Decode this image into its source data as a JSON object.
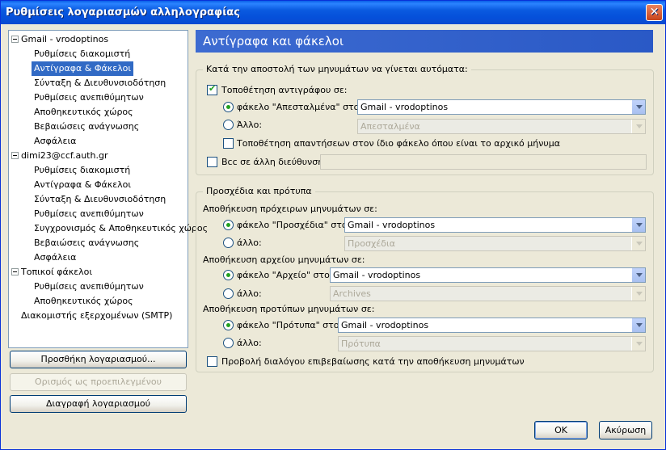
{
  "window": {
    "title": "Ρυθμίσεις λογαριασμών αλληλογραφίας",
    "close_glyph": "✕"
  },
  "tree": [
    {
      "label": "Gmail - vrodoptinos",
      "level": 0,
      "toggle": true
    },
    {
      "label": "Ρυθμίσεις διακομιστή",
      "level": 1
    },
    {
      "label": "Αντίγραφα & Φάκελοι",
      "level": 1,
      "selected": true
    },
    {
      "label": "Σύνταξη & Διευθυνσιοδότηση",
      "level": 1
    },
    {
      "label": "Ρυθμίσεις ανεπιθύμητων",
      "level": 1
    },
    {
      "label": "Αποθηκευτικός χώρος",
      "level": 1
    },
    {
      "label": "Βεβαιώσεις ανάγνωσης",
      "level": 1
    },
    {
      "label": "Ασφάλεια",
      "level": 1
    },
    {
      "label": "dimi23@ccf.auth.gr",
      "level": 0,
      "toggle": true
    },
    {
      "label": "Ρυθμίσεις διακομιστή",
      "level": 1
    },
    {
      "label": "Αντίγραφα & Φάκελοι",
      "level": 1
    },
    {
      "label": "Σύνταξη & Διευθυνσιοδότηση",
      "level": 1
    },
    {
      "label": "Ρυθμίσεις ανεπιθύμητων",
      "level": 1
    },
    {
      "label": "Συγχρονισμός & Αποθηκευτικός χώρος",
      "level": 1
    },
    {
      "label": "Βεβαιώσεις ανάγνωσης",
      "level": 1
    },
    {
      "label": "Ασφάλεια",
      "level": 1
    },
    {
      "label": "Τοπικοί φάκελοι",
      "level": 0,
      "toggle": true
    },
    {
      "label": "Ρυθμίσεις ανεπιθύμητων",
      "level": 1
    },
    {
      "label": "Αποθηκευτικός χώρος",
      "level": 1
    },
    {
      "label": "Διακομιστής εξερχομένων (SMTP)",
      "level": 0
    }
  ],
  "left_buttons": {
    "add": "Προσθήκη λογαριασμού...",
    "set_default": "Ορισμός ως προεπιλεγμένου",
    "remove": "Διαγραφή λογαριασμού"
  },
  "header": {
    "title": "Αντίγραφα και φάκελοι"
  },
  "sending": {
    "group_title": "Κατά την αποστολή των μηνυμάτων να γίνεται αυτόματα:",
    "place_copy": {
      "label": "Τοποθέτηση αντιγράφου σε:",
      "checked": true
    },
    "sent_folder": {
      "label": "φάκελο \"Απεσταλμένα\" στο:",
      "checked": true,
      "value": "Gmail - vrodoptinos"
    },
    "other": {
      "label": "Άλλο:",
      "value": "Απεσταλμένα"
    },
    "reply_same": {
      "label": "Τοποθέτηση απαντήσεων στον ίδιο φάκελο όπου είναι το αρχικό μήνυμα",
      "checked": false
    },
    "bcc": {
      "label": "Bcc σε άλλη διεύθυνση",
      "checked": false,
      "value": ""
    }
  },
  "drafts": {
    "group_title": "Προσχέδια και πρότυπα",
    "drafts_label": "Αποθήκευση πρόχειρων μηνυμάτων σε:",
    "drafts_folder": {
      "label": "φάκελο \"Προσχέδια\" στο:",
      "value": "Gmail - vrodoptinos"
    },
    "drafts_other": {
      "label": "άλλο:",
      "value": "Προσχέδια"
    },
    "archive_label": "Αποθήκευση αρχείου μηνυμάτων σε:",
    "archive_folder": {
      "label": "φάκελο \"Αρχείο\" στο:",
      "value": "Gmail - vrodoptinos"
    },
    "archive_other": {
      "label": "άλλο:",
      "value": "Archives"
    },
    "templates_label": "Αποθήκευση προτύπων μηνυμάτων σε:",
    "templates_folder": {
      "label": "φάκελο \"Πρότυπα\" στο:",
      "value": "Gmail - vrodoptinos"
    },
    "templates_other": {
      "label": "άλλο:",
      "value": "Πρότυπα"
    },
    "confirm_dialog": {
      "label": "Προβολή διαλόγου επιβεβαίωσης κατά την αποθήκευση μηνυμάτων",
      "checked": false
    }
  },
  "footer": {
    "ok": "OK",
    "cancel": "Ακύρωση"
  },
  "colors": {
    "titlebar": "#0a5ae0",
    "selected": "#316ac5",
    "header": "#3d6bd1",
    "check": "#21a121"
  }
}
